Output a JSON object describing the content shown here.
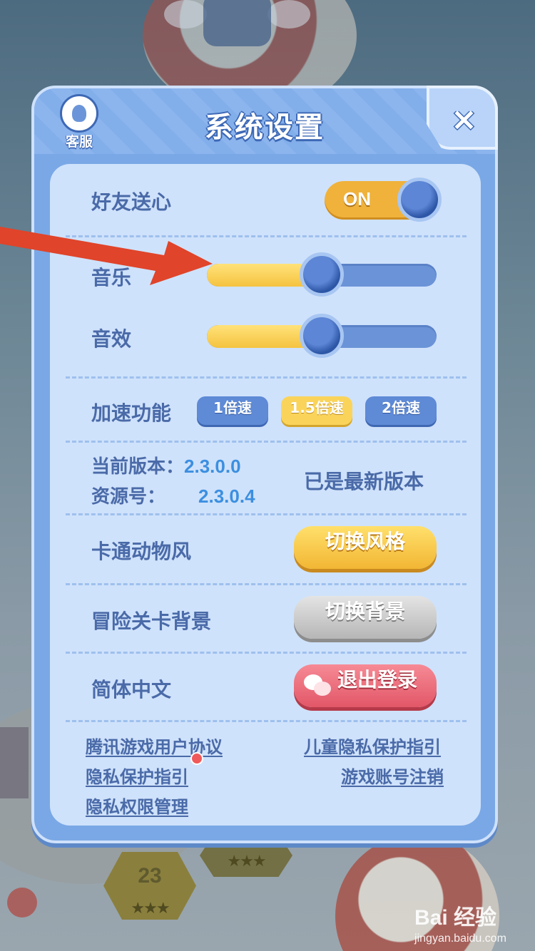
{
  "dialog": {
    "title": "系统设置",
    "service_label": "客服",
    "close_symbol": "×"
  },
  "settings": {
    "friend_hearts": {
      "label": "好友送心",
      "toggle_text": "ON",
      "toggle_on": true
    },
    "music": {
      "label": "音乐",
      "level": 0.5
    },
    "sound": {
      "label": "音效",
      "level": 0.5
    },
    "speed": {
      "label": "加速功能",
      "options": [
        "1倍速",
        "1.5倍速",
        "2倍速"
      ],
      "selected": "1.5倍速"
    },
    "version": {
      "current_label": "当前版本：",
      "current_value": "2.3.0.0",
      "resource_label": "资源号：",
      "resource_value": "2.3.0.4",
      "status": "已是最新版本"
    },
    "style": {
      "label": "卡通动物风",
      "button": "切换风格"
    },
    "background": {
      "label": "冒险关卡背景",
      "button": "切换背景"
    },
    "language": {
      "label": "简体中文",
      "button": "退出登录"
    }
  },
  "links": {
    "user_agreement": "腾讯游戏用户协议",
    "child_privacy": "儿童隐私保护指引",
    "privacy_guide": "隐私保护指引",
    "delete_account": "游戏账号注销",
    "permission_mgmt": "隐私权限管理"
  },
  "background_game": {
    "level_number": "23",
    "stars": "★★★"
  },
  "watermark": {
    "brand": "Bai 经验",
    "site": "jingyan.baidu.com"
  },
  "colors": {
    "accent_blue": "#4a6aa8",
    "toggle_gold": "#f0b23b",
    "annotation_arrow": "#e0442a"
  }
}
